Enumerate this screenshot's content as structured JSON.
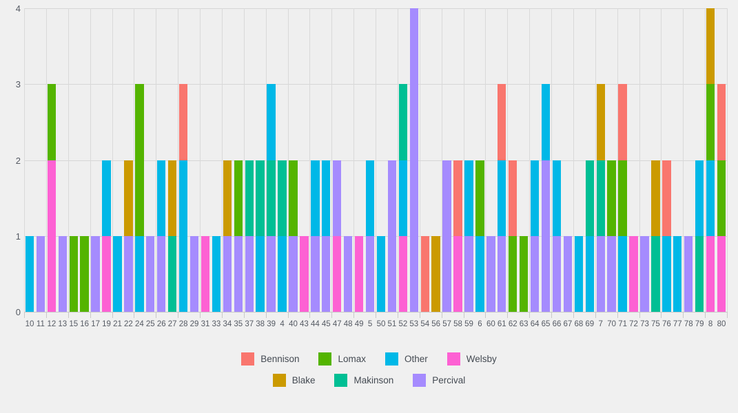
{
  "chart_data": {
    "type": "bar",
    "stacked": true,
    "title": "",
    "subtitle": "",
    "xlabel": "",
    "ylabel": "",
    "ylim": [
      0,
      4
    ],
    "yticks": [
      0,
      1,
      2,
      3,
      4
    ],
    "ytick_labels": [
      "0",
      "1",
      "2",
      "3",
      "4"
    ],
    "grid": true,
    "grid_axes": "both",
    "legend_position": "bottom",
    "background_color": "#f0f0f0",
    "plot_background_color": "#efefef",
    "series_order": [
      "Bennison",
      "Blake",
      "Lomax",
      "Makinson",
      "Other",
      "Percival",
      "Welsby"
    ],
    "legend_rows": [
      [
        {
          "name": "Bennison",
          "color": "#f9766e"
        },
        {
          "name": "Lomax",
          "color": "#54b400"
        },
        {
          "name": "Other",
          "color": "#00b8e7"
        },
        {
          "name": "Welsby",
          "color": "#fd61d3"
        }
      ],
      [
        {
          "name": "Blake",
          "color": "#cb9a00"
        },
        {
          "name": "Makinson",
          "color": "#00bf94"
        },
        {
          "name": "Percival",
          "color": "#a58bfe"
        }
      ]
    ],
    "colors": {
      "Bennison": "#f9766e",
      "Blake": "#cb9a00",
      "Lomax": "#54b400",
      "Makinson": "#00bf94",
      "Other": "#00b8e7",
      "Percival": "#a58bfe",
      "Welsby": "#fd61d3"
    },
    "categories": [
      "10",
      "11",
      "12",
      "13",
      "15",
      "16",
      "17",
      "19",
      "21",
      "22",
      "24",
      "25",
      "26",
      "27",
      "28",
      "29",
      "31",
      "33",
      "34",
      "35",
      "37",
      "38",
      "39",
      "4",
      "40",
      "43",
      "44",
      "45",
      "47",
      "48",
      "49",
      "5",
      "50",
      "51",
      "52",
      "53",
      "54",
      "56",
      "57",
      "58",
      "59",
      "6",
      "60",
      "61",
      "62",
      "63",
      "64",
      "65",
      "66",
      "67",
      "68",
      "69",
      "7",
      "70",
      "71",
      "72",
      "73",
      "75",
      "76",
      "77",
      "78",
      "79",
      "8",
      "80"
    ],
    "bars": [
      {
        "category": "10",
        "total": 1,
        "segments": [
          {
            "series": "Other",
            "value": 1
          }
        ]
      },
      {
        "category": "11",
        "total": 1,
        "segments": [
          {
            "series": "Percival",
            "value": 1
          }
        ]
      },
      {
        "category": "12",
        "total": 3,
        "segments": [
          {
            "series": "Welsby",
            "value": 2
          },
          {
            "series": "Lomax",
            "value": 1
          }
        ]
      },
      {
        "category": "13",
        "total": 1,
        "segments": [
          {
            "series": "Percival",
            "value": 1
          }
        ]
      },
      {
        "category": "15",
        "total": 1,
        "segments": [
          {
            "series": "Lomax",
            "value": 1
          }
        ]
      },
      {
        "category": "16",
        "total": 1,
        "segments": [
          {
            "series": "Lomax",
            "value": 1
          }
        ]
      },
      {
        "category": "17",
        "total": 1,
        "segments": [
          {
            "series": "Percival",
            "value": 1
          }
        ]
      },
      {
        "category": "19",
        "total": 2,
        "segments": [
          {
            "series": "Welsby",
            "value": 1
          },
          {
            "series": "Other",
            "value": 1
          }
        ]
      },
      {
        "category": "21",
        "total": 1,
        "segments": [
          {
            "series": "Other",
            "value": 1
          }
        ]
      },
      {
        "category": "22",
        "total": 2,
        "segments": [
          {
            "series": "Percival",
            "value": 1
          },
          {
            "series": "Blake",
            "value": 1
          }
        ]
      },
      {
        "category": "24",
        "total": 3,
        "segments": [
          {
            "series": "Other",
            "value": 1
          },
          {
            "series": "Lomax",
            "value": 2
          }
        ]
      },
      {
        "category": "25",
        "total": 1,
        "segments": [
          {
            "series": "Percival",
            "value": 1
          }
        ]
      },
      {
        "category": "26",
        "total": 2,
        "segments": [
          {
            "series": "Percival",
            "value": 1
          },
          {
            "series": "Other",
            "value": 1
          }
        ]
      },
      {
        "category": "27",
        "total": 2,
        "segments": [
          {
            "series": "Makinson",
            "value": 1
          },
          {
            "series": "Blake",
            "value": 1
          }
        ]
      },
      {
        "category": "28",
        "total": 3,
        "segments": [
          {
            "series": "Other",
            "value": 2
          },
          {
            "series": "Bennison",
            "value": 1
          }
        ]
      },
      {
        "category": "29",
        "total": 1,
        "segments": [
          {
            "series": "Percival",
            "value": 1
          }
        ]
      },
      {
        "category": "31",
        "total": 1,
        "segments": [
          {
            "series": "Welsby",
            "value": 1
          }
        ]
      },
      {
        "category": "33",
        "total": 1,
        "segments": [
          {
            "series": "Other",
            "value": 1
          }
        ]
      },
      {
        "category": "34",
        "total": 2,
        "segments": [
          {
            "series": "Percival",
            "value": 1
          },
          {
            "series": "Blake",
            "value": 1
          }
        ]
      },
      {
        "category": "35",
        "total": 2,
        "segments": [
          {
            "series": "Percival",
            "value": 1
          },
          {
            "series": "Lomax",
            "value": 1
          }
        ]
      },
      {
        "category": "37",
        "total": 2,
        "segments": [
          {
            "series": "Percival",
            "value": 1
          },
          {
            "series": "Makinson",
            "value": 1
          }
        ]
      },
      {
        "category": "38",
        "total": 2,
        "segments": [
          {
            "series": "Other",
            "value": 1
          },
          {
            "series": "Makinson",
            "value": 1
          }
        ]
      },
      {
        "category": "39",
        "total": 3,
        "segments": [
          {
            "series": "Percival",
            "value": 1
          },
          {
            "series": "Makinson",
            "value": 1
          },
          {
            "series": "Other",
            "value": 1
          }
        ]
      },
      {
        "category": "4",
        "total": 2,
        "segments": [
          {
            "series": "Other",
            "value": 1
          },
          {
            "series": "Makinson",
            "value": 1
          }
        ]
      },
      {
        "category": "40",
        "total": 2,
        "segments": [
          {
            "series": "Percival",
            "value": 1
          },
          {
            "series": "Lomax",
            "value": 1
          }
        ]
      },
      {
        "category": "43",
        "total": 1,
        "segments": [
          {
            "series": "Welsby",
            "value": 1
          }
        ]
      },
      {
        "category": "44",
        "total": 2,
        "segments": [
          {
            "series": "Percival",
            "value": 1
          },
          {
            "series": "Other",
            "value": 1
          }
        ]
      },
      {
        "category": "45",
        "total": 2,
        "segments": [
          {
            "series": "Percival",
            "value": 1
          },
          {
            "series": "Other",
            "value": 1
          }
        ]
      },
      {
        "category": "47",
        "total": 2,
        "segments": [
          {
            "series": "Welsby",
            "value": 1
          },
          {
            "series": "Percival",
            "value": 1
          }
        ]
      },
      {
        "category": "48",
        "total": 1,
        "segments": [
          {
            "series": "Percival",
            "value": 1
          }
        ]
      },
      {
        "category": "49",
        "total": 1,
        "segments": [
          {
            "series": "Welsby",
            "value": 1
          }
        ]
      },
      {
        "category": "5",
        "total": 2,
        "segments": [
          {
            "series": "Percival",
            "value": 1
          },
          {
            "series": "Other",
            "value": 1
          }
        ]
      },
      {
        "category": "50",
        "total": 1,
        "segments": [
          {
            "series": "Other",
            "value": 1
          }
        ]
      },
      {
        "category": "51",
        "total": 2,
        "segments": [
          {
            "series": "Percival",
            "value": 1
          },
          {
            "series": "Percival",
            "value": 1
          }
        ]
      },
      {
        "category": "52",
        "total": 3,
        "segments": [
          {
            "series": "Welsby",
            "value": 1
          },
          {
            "series": "Other",
            "value": 1
          },
          {
            "series": "Makinson",
            "value": 1
          }
        ]
      },
      {
        "category": "53",
        "total": 4,
        "segments": [
          {
            "series": "Percival",
            "value": 4
          }
        ]
      },
      {
        "category": "54",
        "total": 1,
        "segments": [
          {
            "series": "Bennison",
            "value": 1
          }
        ]
      },
      {
        "category": "56",
        "total": 1,
        "segments": [
          {
            "series": "Blake",
            "value": 1
          }
        ]
      },
      {
        "category": "57",
        "total": 2,
        "segments": [
          {
            "series": "Percival",
            "value": 2
          }
        ]
      },
      {
        "category": "58",
        "total": 2,
        "segments": [
          {
            "series": "Welsby",
            "value": 1
          },
          {
            "series": "Bennison",
            "value": 1
          }
        ]
      },
      {
        "category": "59",
        "total": 2,
        "segments": [
          {
            "series": "Percival",
            "value": 1
          },
          {
            "series": "Other",
            "value": 1
          }
        ]
      },
      {
        "category": "6",
        "total": 2,
        "segments": [
          {
            "series": "Other",
            "value": 1
          },
          {
            "series": "Lomax",
            "value": 1
          }
        ]
      },
      {
        "category": "60",
        "total": 1,
        "segments": [
          {
            "series": "Percival",
            "value": 1
          }
        ]
      },
      {
        "category": "61",
        "total": 3,
        "segments": [
          {
            "series": "Percival",
            "value": 1
          },
          {
            "series": "Other",
            "value": 1
          },
          {
            "series": "Bennison",
            "value": 1
          }
        ]
      },
      {
        "category": "62",
        "total": 2,
        "segments": [
          {
            "series": "Lomax",
            "value": 1
          },
          {
            "series": "Bennison",
            "value": 1
          }
        ]
      },
      {
        "category": "63",
        "total": 1,
        "segments": [
          {
            "series": "Lomax",
            "value": 1
          }
        ]
      },
      {
        "category": "64",
        "total": 2,
        "segments": [
          {
            "series": "Percival",
            "value": 1
          },
          {
            "series": "Other",
            "value": 1
          }
        ]
      },
      {
        "category": "65",
        "total": 3,
        "segments": [
          {
            "series": "Percival",
            "value": 2
          },
          {
            "series": "Other",
            "value": 1
          }
        ]
      },
      {
        "category": "66",
        "total": 2,
        "segments": [
          {
            "series": "Percival",
            "value": 1
          },
          {
            "series": "Other",
            "value": 1
          }
        ]
      },
      {
        "category": "67",
        "total": 1,
        "segments": [
          {
            "series": "Percival",
            "value": 1
          }
        ]
      },
      {
        "category": "68",
        "total": 1,
        "segments": [
          {
            "series": "Other",
            "value": 1
          }
        ]
      },
      {
        "category": "69",
        "total": 2,
        "segments": [
          {
            "series": "Other",
            "value": 1
          },
          {
            "series": "Makinson",
            "value": 1
          }
        ]
      },
      {
        "category": "7",
        "total": 3,
        "segments": [
          {
            "series": "Percival",
            "value": 1
          },
          {
            "series": "Makinson",
            "value": 1
          },
          {
            "series": "Blake",
            "value": 1
          }
        ]
      },
      {
        "category": "70",
        "total": 2,
        "segments": [
          {
            "series": "Percival",
            "value": 1
          },
          {
            "series": "Lomax",
            "value": 1
          }
        ]
      },
      {
        "category": "71",
        "total": 3,
        "segments": [
          {
            "series": "Other",
            "value": 1
          },
          {
            "series": "Lomax",
            "value": 1
          },
          {
            "series": "Bennison",
            "value": 1
          }
        ]
      },
      {
        "category": "72",
        "total": 1,
        "segments": [
          {
            "series": "Welsby",
            "value": 1
          }
        ]
      },
      {
        "category": "73",
        "total": 1,
        "segments": [
          {
            "series": "Percival",
            "value": 1
          }
        ]
      },
      {
        "category": "75",
        "total": 2,
        "segments": [
          {
            "series": "Makinson",
            "value": 1
          },
          {
            "series": "Blake",
            "value": 1
          }
        ]
      },
      {
        "category": "76",
        "total": 2,
        "segments": [
          {
            "series": "Other",
            "value": 1
          },
          {
            "series": "Bennison",
            "value": 1
          }
        ]
      },
      {
        "category": "77",
        "total": 1,
        "segments": [
          {
            "series": "Other",
            "value": 1
          }
        ]
      },
      {
        "category": "78",
        "total": 1,
        "segments": [
          {
            "series": "Percival",
            "value": 1
          }
        ]
      },
      {
        "category": "79",
        "total": 2,
        "segments": [
          {
            "series": "Makinson",
            "value": 1
          },
          {
            "series": "Other",
            "value": 1
          }
        ]
      },
      {
        "category": "8",
        "total": 4,
        "segments": [
          {
            "series": "Welsby",
            "value": 1
          },
          {
            "series": "Other",
            "value": 1
          },
          {
            "series": "Lomax",
            "value": 1
          },
          {
            "series": "Blake",
            "value": 1
          }
        ]
      },
      {
        "category": "80",
        "total": 3,
        "segments": [
          {
            "series": "Welsby",
            "value": 1
          },
          {
            "series": "Lomax",
            "value": 1
          },
          {
            "series": "Bennison",
            "value": 1
          }
        ]
      }
    ]
  }
}
